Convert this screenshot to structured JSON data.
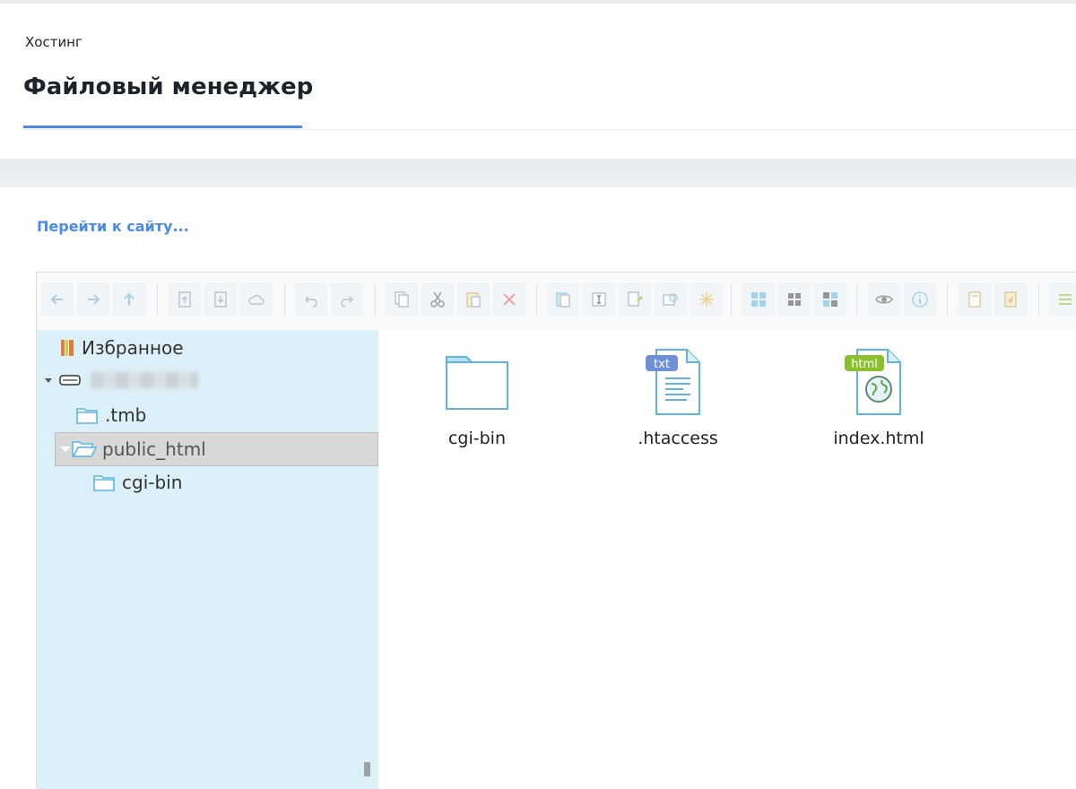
{
  "breadcrumb": "Хостинг",
  "page_title": "Файловый менеджер",
  "goto_link": "Перейти к сайту...",
  "colors": {
    "accent": "#4a8be4",
    "tree_bg": "#dcf0fa",
    "folder_icon": "#5bb6e6",
    "txt_badge": "#6f8fd6",
    "html_badge": "#8bbf2e"
  },
  "toolbar": {
    "groups": [
      [
        "back-icon",
        "forward-icon",
        "up-icon"
      ],
      [
        "upload-icon",
        "download-icon",
        "cloud-icon"
      ],
      [
        "undo-icon",
        "redo-icon"
      ],
      [
        "copy-icon",
        "cut-icon",
        "paste-icon",
        "delete-icon"
      ],
      [
        "duplicate-icon",
        "rename-icon",
        "edit-icon",
        "resize-icon",
        "extract-icon"
      ],
      [
        "view-list-icon",
        "view-grid-icon",
        "sort-icon"
      ],
      [
        "preview-icon",
        "info-icon"
      ],
      [
        "new-file-icon",
        "new-folder-icon"
      ],
      [
        "menu-icon"
      ]
    ]
  },
  "tree": {
    "favorites": "Избранное",
    "root_name": "",
    "items": [
      ".tmb",
      "public_html",
      "cgi-bin"
    ]
  },
  "files": [
    {
      "name": "cgi-bin",
      "type": "folder"
    },
    {
      "name": ".htaccess",
      "type": "txt",
      "badge": "txt"
    },
    {
      "name": "index.html",
      "type": "html",
      "badge": "html"
    }
  ]
}
